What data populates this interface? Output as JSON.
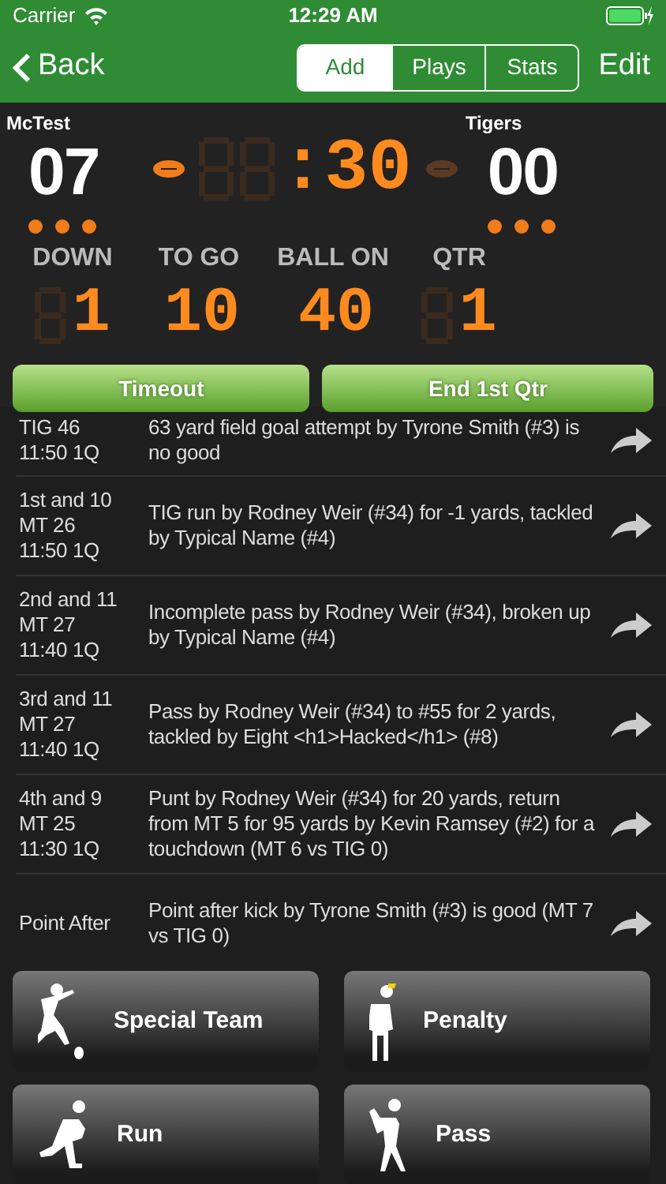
{
  "status_bar": {
    "carrier": "Carrier",
    "time": "12:29 AM"
  },
  "nav": {
    "back": "Back",
    "segments": [
      {
        "label": "Add",
        "selected": true
      },
      {
        "label": "Plays",
        "selected": false
      },
      {
        "label": "Stats",
        "selected": false
      }
    ],
    "edit": "Edit"
  },
  "scoreboard": {
    "home": {
      "name": "McTest",
      "score": "07",
      "possession": true,
      "timeouts": [
        {
          "used": false
        },
        {
          "used": false
        },
        {
          "used": false
        }
      ]
    },
    "away": {
      "name": "Tigers",
      "score": "00",
      "possession": false,
      "timeouts": [
        {
          "used": false
        },
        {
          "used": false
        },
        {
          "used": false
        }
      ]
    },
    "clock": ":30",
    "fields": [
      {
        "label": "DOWN",
        "value": "1"
      },
      {
        "label": "TO GO",
        "value": "10"
      },
      {
        "label": "BALL ON",
        "value": "40"
      },
      {
        "label": "QTR",
        "value": "1"
      }
    ]
  },
  "actions": [
    "Timeout",
    "End 1st Qtr"
  ],
  "plays": [
    {
      "situation": [
        "TIG 46",
        "11:50 1Q"
      ],
      "description": "63 yard field goal attempt by Tyrone Smith (#3) is no good"
    },
    {
      "situation": [
        "1st and 10",
        "MT 26",
        "11:50 1Q"
      ],
      "description": "TIG run by Rodney Weir (#34) for -1 yards, tackled by Typical Name (#4)"
    },
    {
      "situation": [
        "2nd and 11",
        "MT 27",
        "11:40 1Q"
      ],
      "description": "Incomplete pass by Rodney Weir (#34), broken up by Typical Name (#4)"
    },
    {
      "situation": [
        "3rd and 11",
        "MT 27",
        "11:40 1Q"
      ],
      "description": "Pass by Rodney Weir (#34) to #55 for 2 yards, tackled by Eight <h1>Hacked</h1> (#8)"
    },
    {
      "situation": [
        "4th and 9",
        "MT 25",
        "11:30 1Q"
      ],
      "description": "Punt by Rodney Weir (#34) for 20 yards, return from MT 5 for 95 yards by Kevin Ramsey (#2) for a touchdown (MT 6 vs TIG 0)"
    },
    {
      "situation": [
        "Point After"
      ],
      "description": "Point after kick by Tyrone Smith (#3) is good (MT 7 vs TIG 0)"
    }
  ],
  "play_buttons": [
    {
      "label": "Special Team",
      "kind": "kicker"
    },
    {
      "label": "Penalty",
      "kind": "referee"
    },
    {
      "label": "Run",
      "kind": "runner"
    },
    {
      "label": "Pass",
      "kind": "passer"
    }
  ]
}
